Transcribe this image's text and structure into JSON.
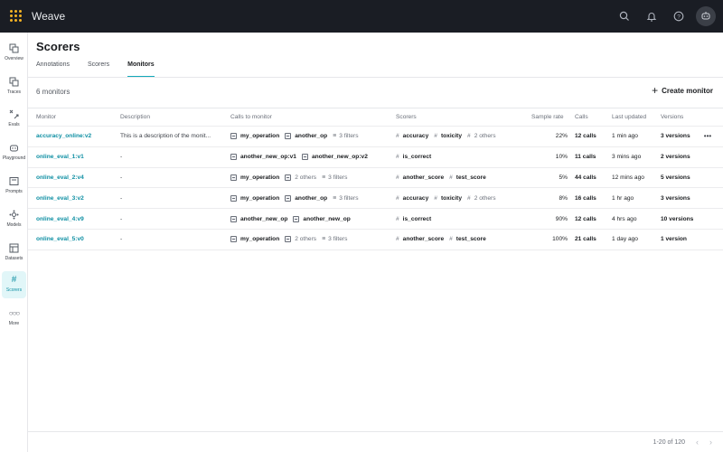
{
  "app": {
    "title": "Weave"
  },
  "sidebar": {
    "items": [
      {
        "label": "Overview",
        "icon": "overview-icon"
      },
      {
        "label": "Traces",
        "icon": "traces-icon"
      },
      {
        "label": "Evals",
        "icon": "evals-icon"
      },
      {
        "label": "Playground",
        "icon": "playground-icon"
      },
      {
        "label": "Prompts",
        "icon": "prompts-icon"
      },
      {
        "label": "Models",
        "icon": "models-icon"
      },
      {
        "label": "Datasets",
        "icon": "datasets-icon"
      },
      {
        "label": "Scorers",
        "icon": "scorers-icon",
        "active": true
      },
      {
        "label": "More",
        "icon": "more-icon"
      }
    ]
  },
  "page": {
    "title": "Scorers",
    "tabs": [
      {
        "label": "Annotations"
      },
      {
        "label": "Scorers"
      },
      {
        "label": "Monitors",
        "active": true
      }
    ],
    "count": "6 monitors",
    "create_label": "Create monitor"
  },
  "table": {
    "headers": {
      "monitor": "Monitor",
      "description": "Description",
      "calls_to_monitor": "Calls to monitor",
      "scorers": "Scorers",
      "sample_rate": "Sample rate",
      "calls": "Calls",
      "last_updated": "Last updated",
      "versions": "Versions"
    },
    "rows": [
      {
        "monitor": "accuracy_online:v2",
        "description": "This is a description of the monit...",
        "ops": [
          "my_operation",
          "another_op"
        ],
        "ops_extra": "",
        "filters": "3 filters",
        "scorers": [
          "accuracy",
          "toxicity"
        ],
        "scorers_extra": "2 others",
        "sample_rate": "22%",
        "calls": "12 calls",
        "last_updated": "1 min ago",
        "versions": "3 versions"
      },
      {
        "monitor": "online_eval_1:v1",
        "description": "-",
        "ops": [
          "another_new_op:v1",
          "another_new_op:v2"
        ],
        "ops_extra": "",
        "filters": "",
        "scorers": [
          "is_correct"
        ],
        "scorers_extra": "",
        "sample_rate": "10%",
        "calls": "11 calls",
        "last_updated": "3 mins ago",
        "versions": "2 versions"
      },
      {
        "monitor": "online_eval_2:v4",
        "description": "-",
        "ops": [
          "my_operation"
        ],
        "ops_extra": "2 others",
        "filters": "3 filters",
        "scorers": [
          "another_score",
          "test_score"
        ],
        "scorers_extra": "",
        "sample_rate": "5%",
        "calls": "44 calls",
        "last_updated": "12 mins ago",
        "versions": "5 versions"
      },
      {
        "monitor": "online_eval_3:v2",
        "description": "-",
        "ops": [
          "my_operation",
          "another_op"
        ],
        "ops_extra": "",
        "filters": "3 filters",
        "scorers": [
          "accuracy",
          "toxicity"
        ],
        "scorers_extra": "2 others",
        "sample_rate": "8%",
        "calls": "16 calls",
        "last_updated": "1 hr ago",
        "versions": "3 versions"
      },
      {
        "monitor": "online_eval_4:v9",
        "description": "-",
        "ops": [
          "another_new_op",
          "another_new_op"
        ],
        "ops_extra": "",
        "filters": "",
        "scorers": [
          "is_correct"
        ],
        "scorers_extra": "",
        "sample_rate": "90%",
        "calls": "12 calls",
        "last_updated": "4 hrs ago",
        "versions": "10 versions"
      },
      {
        "monitor": "online_eval_5:v0",
        "description": "-",
        "ops": [
          "my_operation"
        ],
        "ops_extra": "2 others",
        "filters": "3 filters",
        "scorers": [
          "another_score",
          "test_score"
        ],
        "scorers_extra": "",
        "sample_rate": "100%",
        "calls": "21 calls",
        "last_updated": "1 day ago",
        "versions": "1 version"
      }
    ]
  },
  "pagination": {
    "label": "1-20 of 120"
  },
  "colors": {
    "accent": "#13a9ba",
    "link": "#0e8fa3",
    "topbar": "#1a1d24",
    "logo": "#f5b324"
  }
}
